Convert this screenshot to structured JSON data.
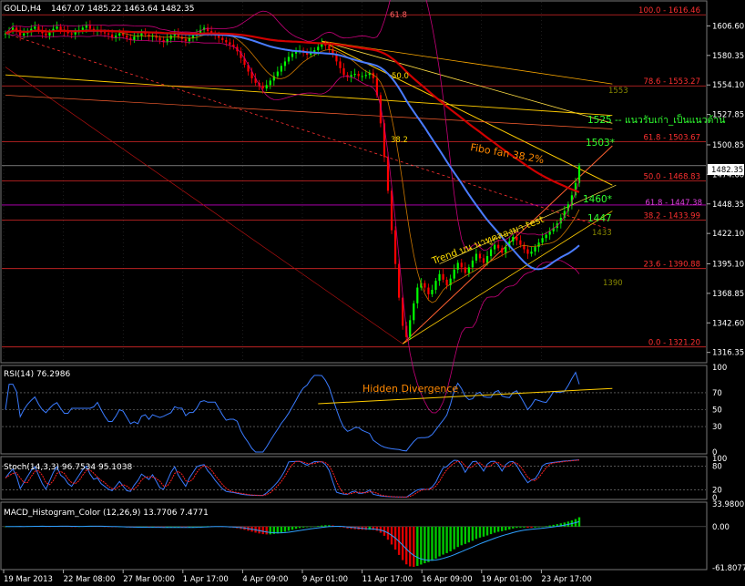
{
  "header": {
    "symbol": "GOLD,H4",
    "ohlc": "1467.07 1485.22 1463.64 1482.35",
    "rsi": "RSI(14) 76.2986",
    "stoch": "Stoch(14,3,3) 96.7534 95.1038",
    "macd": "MACD_Histogram_Color (12,26,9) 13.7706 7.4771"
  },
  "colors": {
    "background": "#000000",
    "grid": "#3a3a3a",
    "bull_candle": "#00ff00",
    "bear_candle": "#ff0000",
    "ma_red": "#d00000",
    "ma_blue": "#4a7cff",
    "bollinger": "#c8007a",
    "fibo": "#ff3030",
    "fan": "#ffcc00",
    "annotation": "#ff8800",
    "hist_green": "#00c800",
    "hist_red": "#dd0000"
  },
  "annotations": {
    "fibo_fan": "Fibo fan 38.2%",
    "trend": "Trend บน นาทูคลองมา test",
    "hidden_div": "Hidden Divergence",
    "lvl1525": "1525 -- แนวรับเก่า_เป็นแนวต้าน",
    "lvl1503": "1503*",
    "lvl1460": "1460*",
    "lvl1447": "1447",
    "fan618": "61.8",
    "fan50": "50.0",
    "fan382": "38.2",
    "v1553": "1553",
    "v1433": "1433",
    "v1390": "1390"
  },
  "fibo_levels": [
    {
      "label": "100.0 - 1616.46",
      "price": 1616.46
    },
    {
      "label": "78.6 - 1553.27",
      "price": 1553.27
    },
    {
      "label": "61.8 - 1503.67",
      "price": 1503.67
    },
    {
      "label": "50.0 - 1468.83",
      "price": 1468.83
    },
    {
      "label": "38.2 - 1433.99",
      "price": 1433.99
    },
    {
      "label": "23.6 - 1390.88",
      "price": 1390.88
    },
    {
      "label": "0.0 - 1321.20",
      "price": 1321.2
    }
  ],
  "extra_level": {
    "label": "61.8 - 1447.38",
    "price": 1447.38
  },
  "chart_data": {
    "type": "candlestick",
    "price_axis": {
      "ticks": [
        "1606.60",
        "1580.35",
        "1554.10",
        "1527.85",
        "1500.85",
        "1474.60",
        "1448.35",
        "1422.10",
        "1395.10",
        "1368.85",
        "1342.60",
        "1316.35"
      ],
      "ylim": [
        1308.0,
        1628.0
      ]
    },
    "current_price": "1482.35",
    "x_ticks": [
      "19 Mar 2013",
      "22 Mar 08:00",
      "27 Mar 00:00",
      "1 Apr 17:00",
      "4 Apr 09:00",
      "9 Apr 01:00",
      "11 Apr 17:00",
      "16 Apr 09:00",
      "19 Apr 01:00",
      "23 Apr 17:00"
    ],
    "close": [
      1600,
      1602,
      1605,
      1603,
      1598,
      1600,
      1602,
      1604,
      1606,
      1603,
      1600,
      1598,
      1601,
      1604,
      1606,
      1603,
      1602,
      1600,
      1599,
      1601,
      1603,
      1605,
      1607,
      1604,
      1602,
      1603,
      1601,
      1600,
      1599,
      1596,
      1598,
      1600,
      1598,
      1596,
      1594,
      1597,
      1598,
      1600,
      1599,
      1597,
      1598,
      1596,
      1594,
      1592,
      1595,
      1598,
      1600,
      1597,
      1595,
      1593,
      1596,
      1598,
      1600,
      1603,
      1605,
      1602,
      1600,
      1598,
      1596,
      1594,
      1592,
      1590,
      1588,
      1584,
      1578,
      1572,
      1566,
      1560,
      1556,
      1553,
      1551,
      1554,
      1558,
      1562,
      1566,
      1571,
      1575,
      1579,
      1582,
      1584,
      1585,
      1583,
      1581,
      1583,
      1585,
      1588,
      1591,
      1589,
      1586,
      1581,
      1575,
      1569,
      1563,
      1561,
      1563,
      1564,
      1562,
      1562,
      1563,
      1565,
      1560,
      1545,
      1520,
      1490,
      1460,
      1425,
      1395,
      1365,
      1340,
      1330,
      1345,
      1360,
      1374,
      1378,
      1374,
      1368,
      1372,
      1380,
      1386,
      1381,
      1376,
      1382,
      1390,
      1396,
      1392,
      1387,
      1392,
      1398,
      1404,
      1400,
      1396,
      1402,
      1408,
      1412,
      1409,
      1405,
      1410,
      1415,
      1419,
      1416,
      1412,
      1408,
      1404,
      1406,
      1410,
      1414,
      1418,
      1421,
      1424,
      1427,
      1431,
      1436,
      1442,
      1448,
      1456,
      1467,
      1482
    ],
    "ylim_rsi": [
      0,
      100
    ],
    "rsi_ticks": [
      "100",
      "70",
      "50",
      "30",
      "0"
    ],
    "stoch_ticks": [
      "100",
      "80",
      "20",
      "0"
    ],
    "macd_ticks": [
      "33.9800",
      "0.00",
      "-61.8077"
    ]
  }
}
